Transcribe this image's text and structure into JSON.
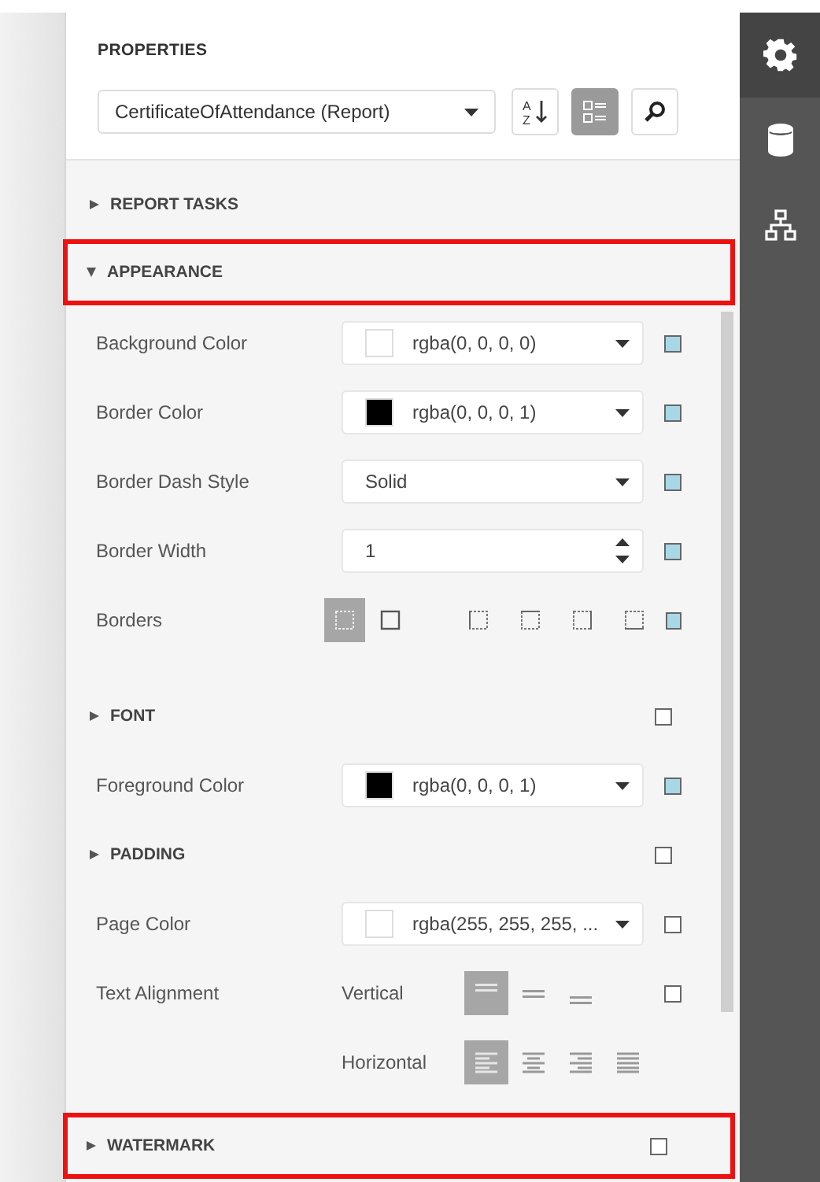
{
  "panel": {
    "title": "PROPERTIES",
    "object_select": {
      "value": "CertificateOfAttendance (Report)"
    },
    "toolbar": [
      {
        "kind": "sort",
        "selected": false,
        "letters": [
          "A",
          "Z"
        ]
      },
      {
        "kind": "categories",
        "selected": true
      },
      {
        "kind": "search",
        "selected": false
      }
    ]
  },
  "sidebar": [
    {
      "kind": "settings",
      "selected": true
    },
    {
      "kind": "database",
      "selected": false
    },
    {
      "kind": "structure",
      "selected": false
    }
  ],
  "sections": [
    {
      "kind": "group",
      "label": "REPORT TASKS",
      "expanded": false,
      "highlighted": false
    },
    {
      "kind": "group",
      "label": "APPEARANCE",
      "expanded": true,
      "highlighted": true
    },
    {
      "kind": "color",
      "label": "Background Color",
      "value": "rgba(0, 0, 0, 0)",
      "color": "#ffffff",
      "modified": true
    },
    {
      "kind": "color",
      "label": "Border Color",
      "value": "rgba(0, 0, 0, 1)",
      "color": "#000000",
      "modified": true
    },
    {
      "kind": "select",
      "label": "Border Dash Style",
      "value": "Solid",
      "modified": true
    },
    {
      "kind": "number",
      "label": "Border Width",
      "value": "1",
      "modified": true
    },
    {
      "kind": "borders",
      "label": "Borders",
      "modified": true,
      "options": [
        {
          "kind": "none",
          "selected": true
        },
        {
          "kind": "all",
          "selected": false
        },
        {
          "kind": "left",
          "selected": false
        },
        {
          "kind": "top",
          "selected": false
        },
        {
          "kind": "right",
          "selected": false
        },
        {
          "kind": "bottom",
          "selected": false
        }
      ]
    },
    {
      "kind": "group",
      "label": "FONT",
      "expanded": false,
      "highlighted": false,
      "modified": false
    },
    {
      "kind": "color",
      "label": "Foreground Color",
      "value": "rgba(0, 0, 0, 1)",
      "color": "#000000",
      "modified": true
    },
    {
      "kind": "group",
      "label": "PADDING",
      "expanded": false,
      "highlighted": false,
      "modified": false
    },
    {
      "kind": "color",
      "label": "Page Color",
      "value": "rgba(255, 255, 255, ...",
      "color": "#ffffff",
      "modified": false
    },
    {
      "kind": "alignment",
      "label": "Text Alignment",
      "modified": false,
      "groups": [
        {
          "label": "Vertical",
          "options": [
            {
              "kind": "top",
              "selected": true
            },
            {
              "kind": "middle",
              "selected": false
            },
            {
              "kind": "bottom",
              "selected": false
            }
          ]
        },
        {
          "label": "Horizontal",
          "options": [
            {
              "kind": "left",
              "selected": true
            },
            {
              "kind": "center",
              "selected": false
            },
            {
              "kind": "right",
              "selected": false
            },
            {
              "kind": "justify",
              "selected": false
            }
          ]
        }
      ]
    },
    {
      "kind": "group",
      "label": "WATERMARK",
      "expanded": false,
      "highlighted": true,
      "modified": false
    }
  ]
}
